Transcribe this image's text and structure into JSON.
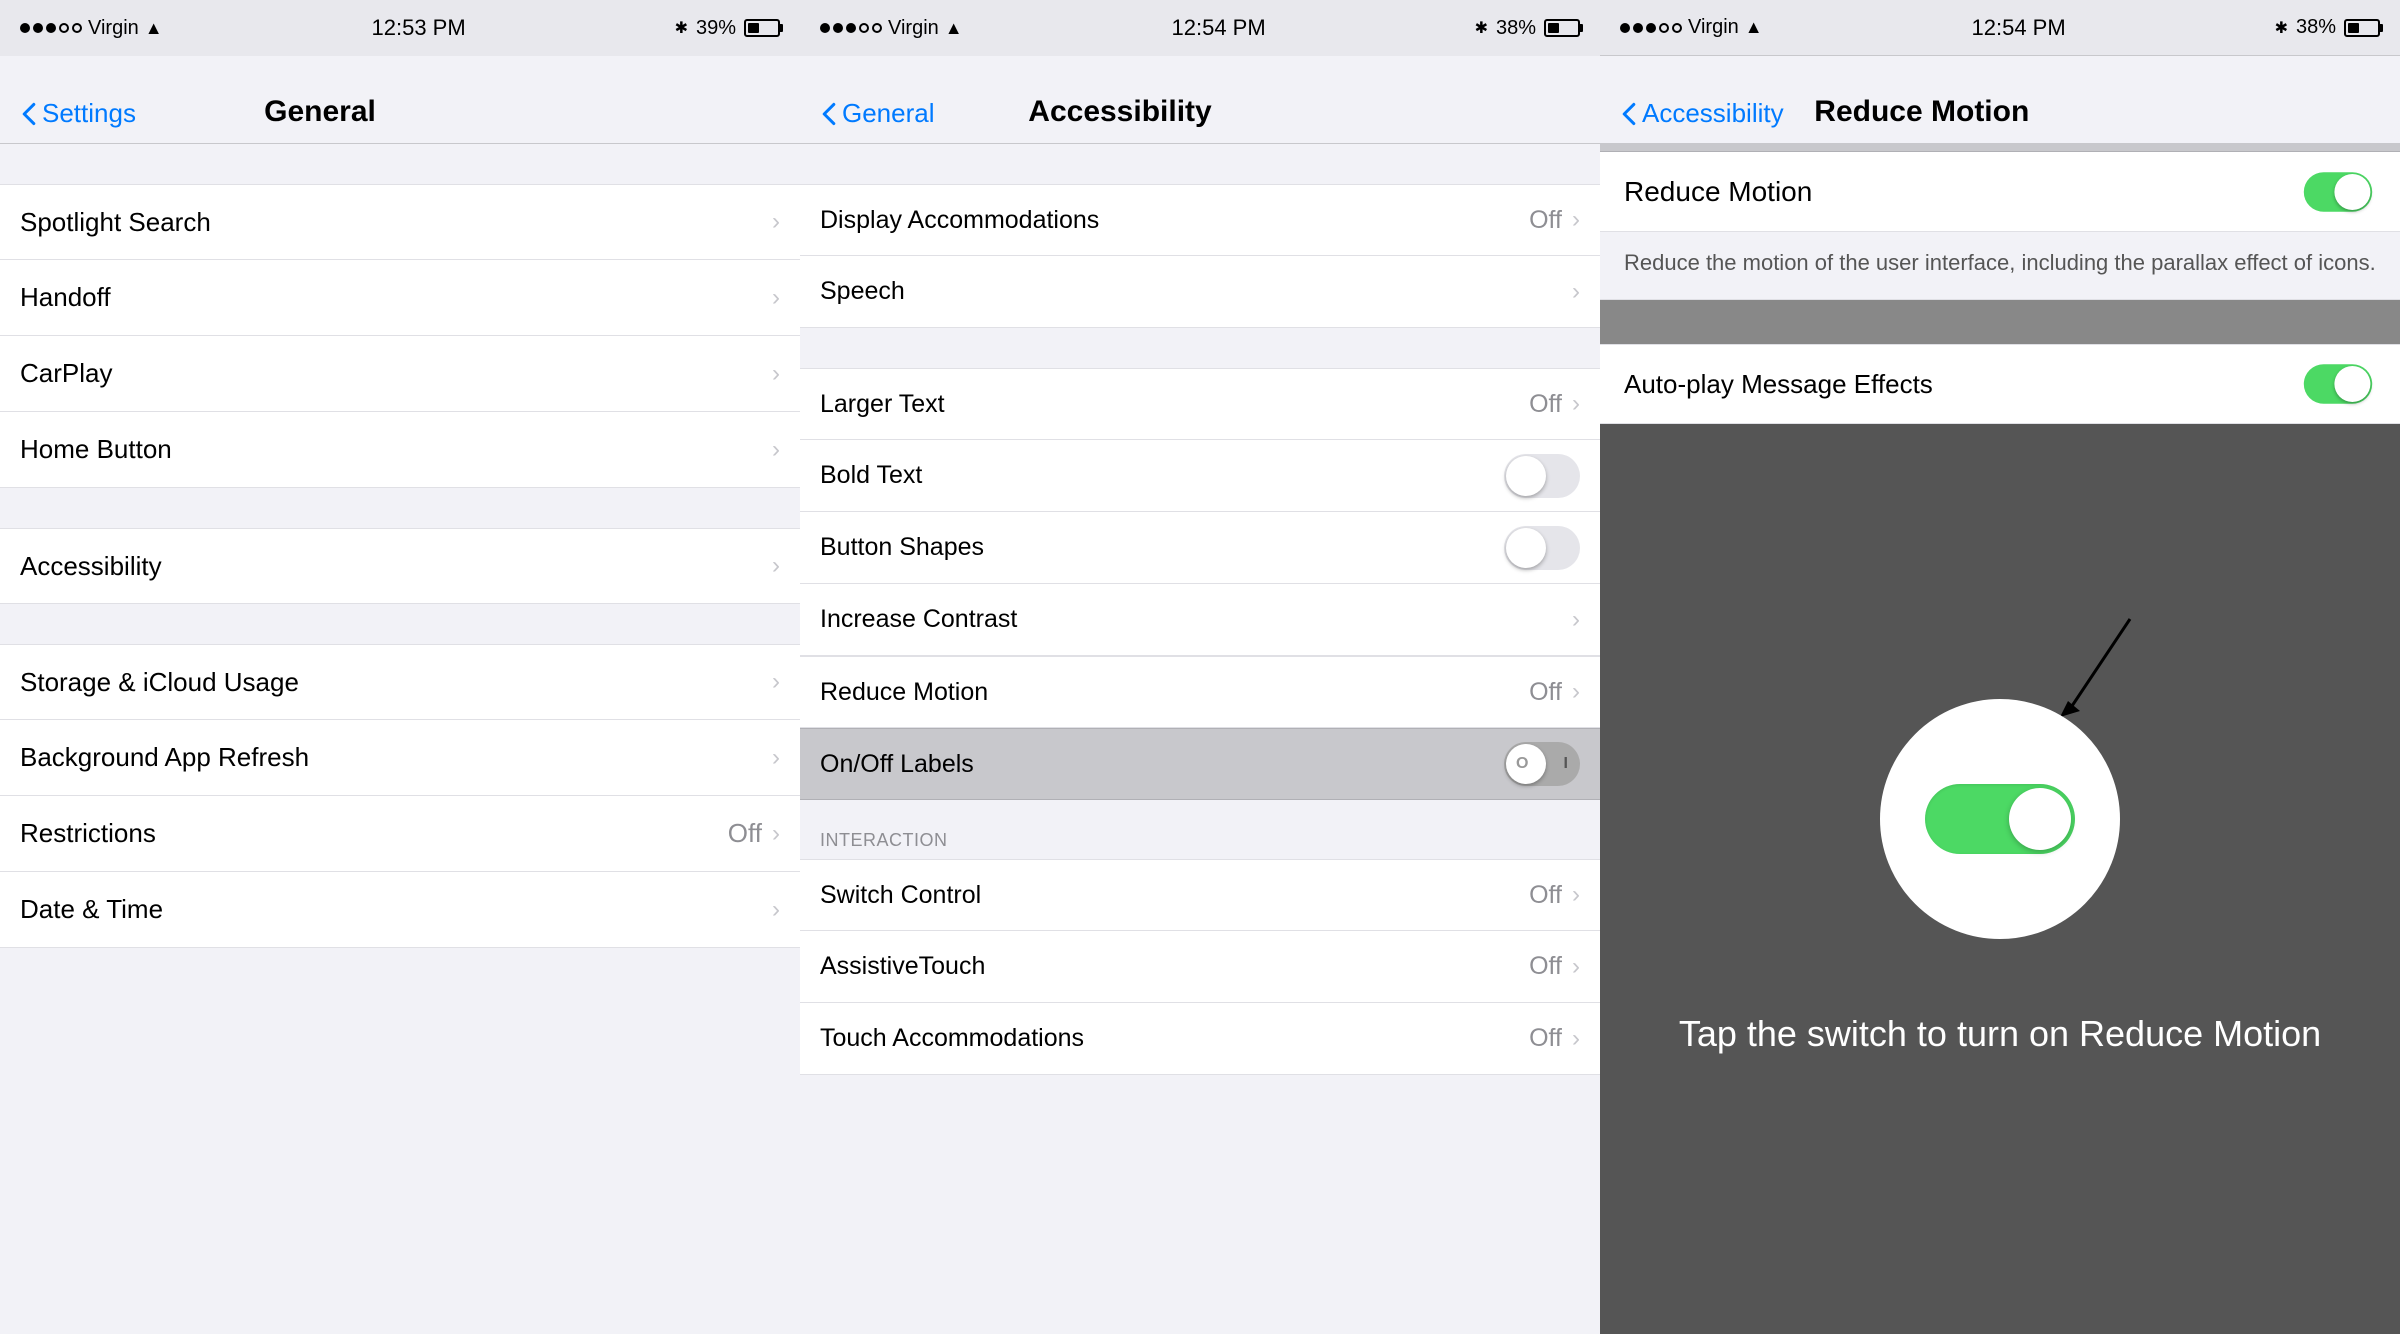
{
  "panel1": {
    "status": {
      "carrier": "Virgin",
      "time": "12:53 PM",
      "battery": "39%",
      "batteryWidth": "39%"
    },
    "nav": {
      "back": "Settings",
      "title": "General"
    },
    "items": [
      {
        "id": "spotlight-search",
        "label": "Spotlight Search",
        "value": "",
        "showChevron": true,
        "showToggle": false
      },
      {
        "id": "handoff",
        "label": "Handoff",
        "value": "",
        "showChevron": true,
        "showToggle": false
      },
      {
        "id": "carplay",
        "label": "CarPlay",
        "value": "",
        "showChevron": true,
        "showToggle": false
      },
      {
        "id": "home-button",
        "label": "Home Button",
        "value": "",
        "showChevron": true,
        "showToggle": false
      },
      {
        "id": "accessibility",
        "label": "Accessibility",
        "value": "",
        "showChevron": true,
        "showToggle": false,
        "selected": true
      },
      {
        "id": "storage-icloud",
        "label": "Storage & iCloud Usage",
        "value": "",
        "showChevron": true,
        "showToggle": false
      },
      {
        "id": "background-app-refresh",
        "label": "Background App Refresh",
        "value": "",
        "showChevron": true,
        "showToggle": false
      },
      {
        "id": "restrictions",
        "label": "Restrictions",
        "value": "Off",
        "showChevron": true,
        "showToggle": false
      },
      {
        "id": "date-time",
        "label": "Date & Time",
        "value": "",
        "showChevron": true,
        "showToggle": false
      }
    ]
  },
  "panel2": {
    "status": {
      "carrier": "Virgin",
      "time": "12:54 PM",
      "battery": "38%",
      "batteryWidth": "38%"
    },
    "nav": {
      "back": "General",
      "title": "Accessibility"
    },
    "groups": [
      {
        "items": [
          {
            "id": "display-accommodations",
            "label": "Display Accommodations",
            "value": "Off",
            "showChevron": true,
            "showToggle": false
          },
          {
            "id": "speech",
            "label": "Speech",
            "value": "",
            "showChevron": true,
            "showToggle": false
          }
        ]
      },
      {
        "items": [
          {
            "id": "larger-text",
            "label": "Larger Text",
            "value": "Off",
            "showChevron": true,
            "showToggle": false
          },
          {
            "id": "bold-text",
            "label": "Bold Text",
            "value": "",
            "showChevron": false,
            "showToggle": true,
            "toggleOn": false
          },
          {
            "id": "button-shapes",
            "label": "Button Shapes",
            "value": "",
            "showChevron": false,
            "showToggle": true,
            "toggleOn": false
          },
          {
            "id": "increase-contrast",
            "label": "Increase Contrast",
            "value": "",
            "showChevron": true,
            "showToggle": false
          }
        ]
      },
      {
        "items": [
          {
            "id": "reduce-motion",
            "label": "Reduce Motion",
            "value": "Off",
            "showChevron": true,
            "showToggle": false
          }
        ]
      },
      {
        "items": [
          {
            "id": "on-off-labels",
            "label": "On/Off Labels",
            "value": "",
            "showChevron": false,
            "showToggle": true,
            "toggleOn": false
          }
        ]
      },
      {
        "sectionHeader": "INTERACTION",
        "items": [
          {
            "id": "switch-control",
            "label": "Switch Control",
            "value": "Off",
            "showChevron": true,
            "showToggle": false
          },
          {
            "id": "assistive-touch",
            "label": "AssistiveTouch",
            "value": "Off",
            "showChevron": true,
            "showToggle": false
          },
          {
            "id": "touch-accommodations",
            "label": "Touch Accommodations",
            "value": "Off",
            "showChevron": true,
            "showToggle": false
          }
        ]
      }
    ]
  },
  "panel3": {
    "status": {
      "carrier": "Virgin",
      "time": "12:54 PM",
      "battery": "38%",
      "batteryWidth": "38%"
    },
    "nav": {
      "back": "Accessibility",
      "title": "Reduce Motion"
    },
    "reduce_motion_label": "Reduce Motion",
    "reduce_motion_desc": "Reduce the motion of the user interface, including the parallax effect of icons.",
    "auto_play_label": "Auto-play Message Effects",
    "annotation_text": "Tap the switch to turn on Reduce Motion"
  }
}
